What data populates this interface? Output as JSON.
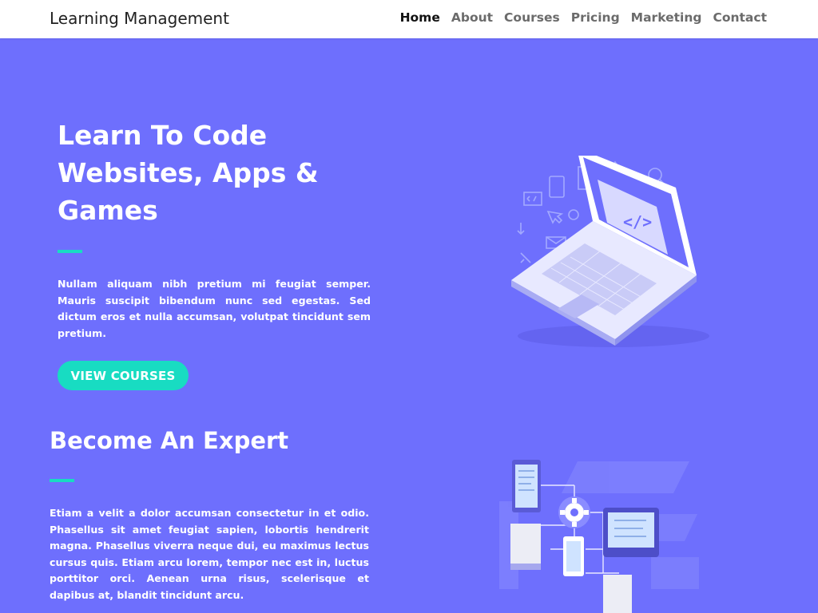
{
  "header": {
    "brand": "Learning Management",
    "nav": [
      "Home",
      "About",
      "Courses",
      "Pricing",
      "Marketing",
      "Contact"
    ],
    "active_nav": "Home"
  },
  "hero": {
    "title": "Learn To Code Websites, Apps & Games",
    "description": "Nullam aliquam nibh pretium mi feugiat semper. Mauris suscipit bibendum nunc sed egestas. Sed dictum eros et nulla accumsan, volutpat tincidunt sem pretium.",
    "cta_label": "VIEW COURSES"
  },
  "expert": {
    "title": "Become An Expert",
    "description": "Etiam a velit a dolor accumsan consectetur in et odio. Phasellus sit amet feugiat sapien, lobortis hendrerit magna. Phasellus viverra neque dui, eu maximus lectus cursus quis. Etiam arcu lorem, tempor nec est in, luctus porttitor orci. Aenean urna risus, scelerisque et dapibus at, blandit tincidunt arcu."
  },
  "illustrations": {
    "hero_icon": "laptop-code-icon",
    "expert_icon": "network-devices-icon"
  },
  "colors": {
    "background": "#6e6ffd",
    "accent": "#18dcc2",
    "header_bg": "#ffffff"
  }
}
